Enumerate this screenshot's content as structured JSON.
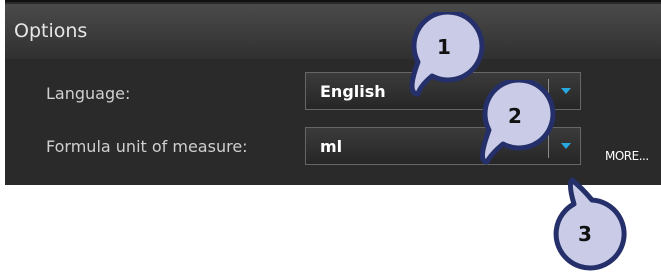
{
  "panel": {
    "title": "Options"
  },
  "language": {
    "label": "Language:",
    "value": "English"
  },
  "formula_unit": {
    "label": "Formula unit of measure:",
    "value": "ml"
  },
  "more_link": "MORE...",
  "callouts": [
    "1",
    "2",
    "3"
  ],
  "colors": {
    "panel_bg": "#2a2a2a",
    "header_bg": "#3c3c3c",
    "dropdown_arrow": "#29a9e1",
    "callout_fill": "#c9cbe7",
    "callout_stroke": "#25306a"
  }
}
